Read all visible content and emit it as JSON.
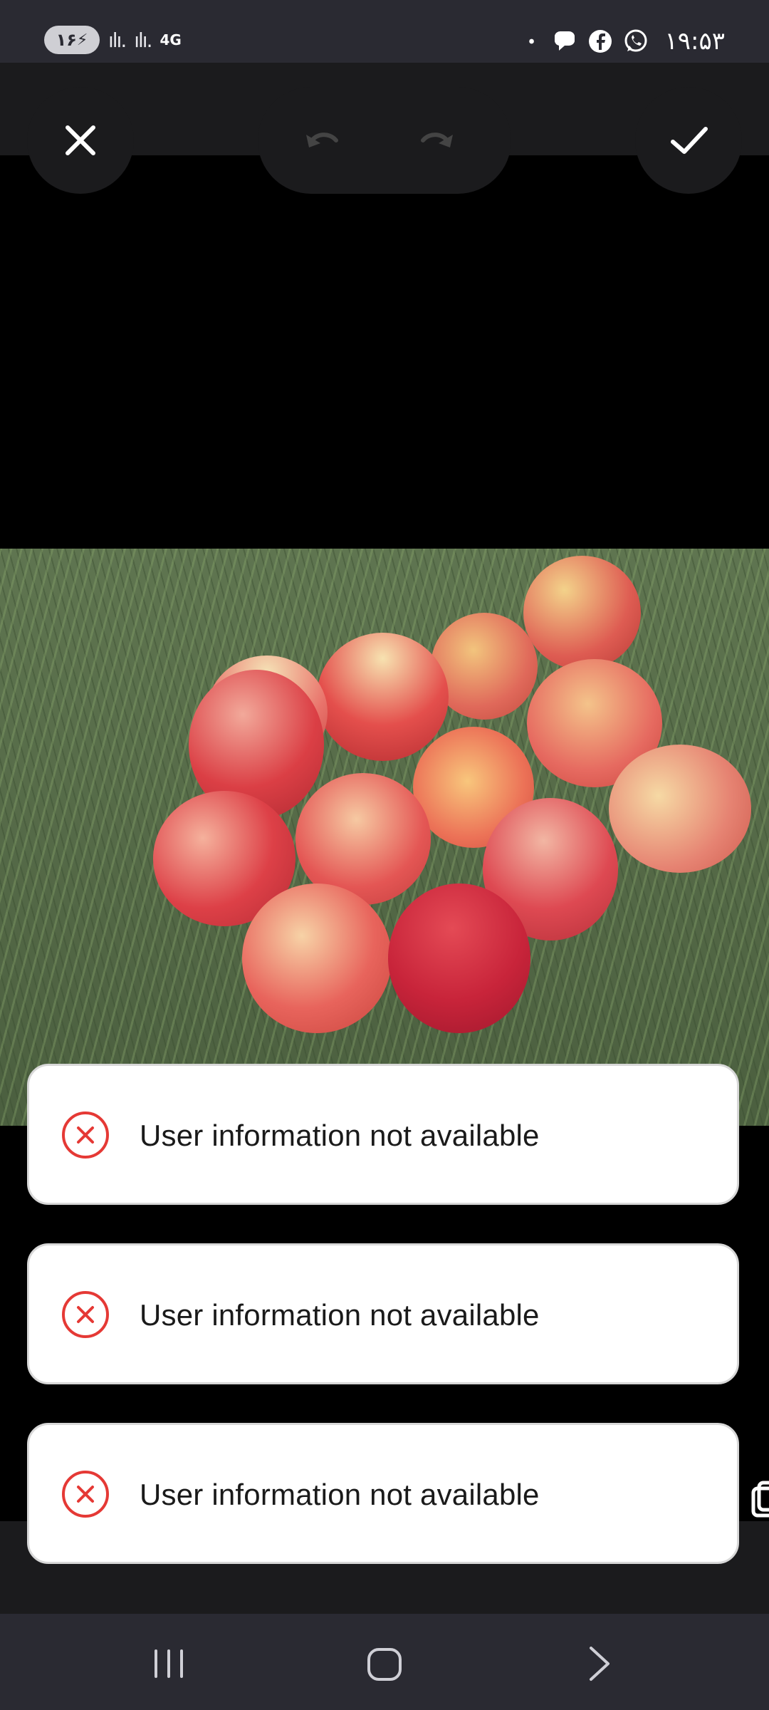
{
  "status_bar": {
    "battery_level": "۱۶",
    "network_type": "4G",
    "time": "۱۹:۵۳",
    "icons": [
      "dot-icon",
      "chat-icon",
      "facebook-icon",
      "whatsapp-icon"
    ]
  },
  "toolbar": {
    "close_icon": "close-icon",
    "undo_icon": "undo-icon",
    "redo_icon": "redo-icon",
    "confirm_icon": "check-icon"
  },
  "toasts": [
    {
      "message": "User information not available",
      "icon": "error-x-icon"
    },
    {
      "message": "User information not available",
      "icon": "error-x-icon"
    },
    {
      "message": "User information not available",
      "icon": "error-x-icon"
    }
  ],
  "colors": {
    "error_red": "#e53935",
    "toolbar_bg": "#1b1b1d",
    "status_bar_bg": "#2a2a32"
  },
  "nav_bar": {
    "icons": [
      "recent-apps-icon",
      "home-icon",
      "back-icon"
    ]
  }
}
